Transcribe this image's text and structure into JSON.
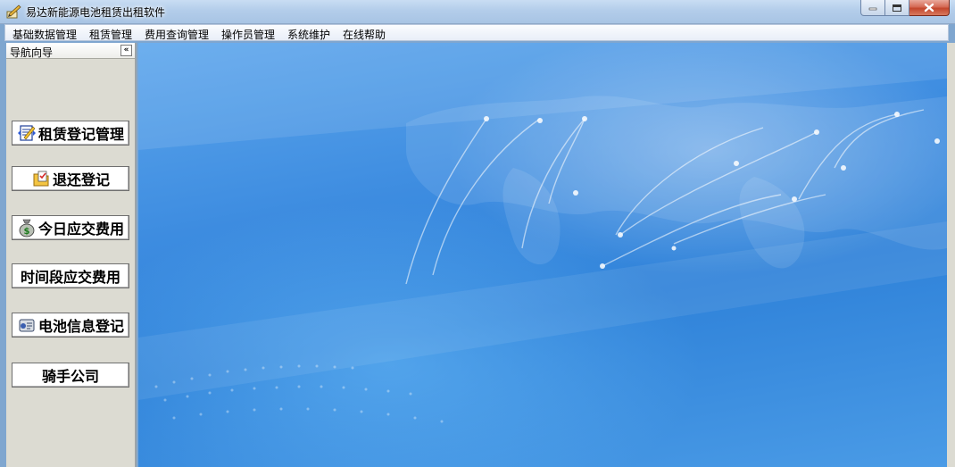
{
  "window": {
    "title": "易达新能源电池租赁出租软件"
  },
  "menu": {
    "items": [
      {
        "label": "基础数据管理"
      },
      {
        "label": "租赁管理"
      },
      {
        "label": "费用查询管理"
      },
      {
        "label": "操作员管理"
      },
      {
        "label": "系统维护"
      },
      {
        "label": "在线帮助"
      }
    ]
  },
  "nav": {
    "header": "导航向导",
    "collapse_glyph": "«",
    "buttons": [
      {
        "label": "租赁登记管理",
        "icon": "rental-register-icon"
      },
      {
        "label": "退还登记",
        "icon": "return-register-icon"
      },
      {
        "label": "今日应交费用",
        "icon": "money-bag-icon"
      },
      {
        "label": "时间段应交费用",
        "icon": ""
      },
      {
        "label": "电池信息登记",
        "icon": "battery-info-icon"
      },
      {
        "label": "骑手公司",
        "icon": ""
      }
    ]
  },
  "colors": {
    "title_bar": "#b3cdea",
    "nav_panel": "#dcdbd2",
    "main_background": "#3d8ce0",
    "close_button": "#c3462c"
  }
}
